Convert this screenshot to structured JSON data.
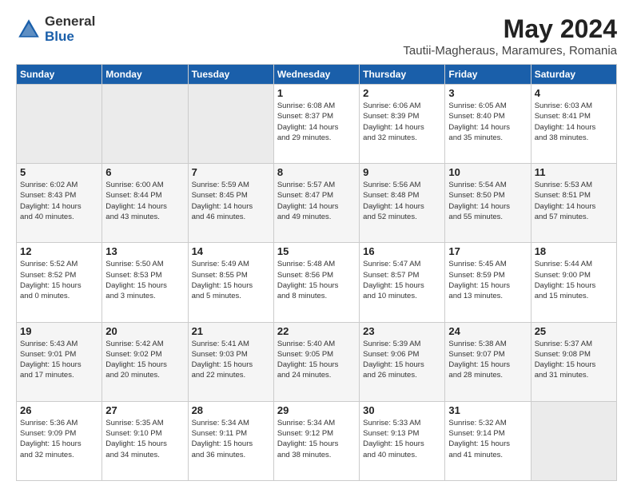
{
  "header": {
    "logo_general": "General",
    "logo_blue": "Blue",
    "month_year": "May 2024",
    "location": "Tautii-Magheraus, Maramures, Romania"
  },
  "weekdays": [
    "Sunday",
    "Monday",
    "Tuesday",
    "Wednesday",
    "Thursday",
    "Friday",
    "Saturday"
  ],
  "weeks": [
    [
      {
        "day": "",
        "info": ""
      },
      {
        "day": "",
        "info": ""
      },
      {
        "day": "",
        "info": ""
      },
      {
        "day": "1",
        "info": "Sunrise: 6:08 AM\nSunset: 8:37 PM\nDaylight: 14 hours\nand 29 minutes."
      },
      {
        "day": "2",
        "info": "Sunrise: 6:06 AM\nSunset: 8:39 PM\nDaylight: 14 hours\nand 32 minutes."
      },
      {
        "day": "3",
        "info": "Sunrise: 6:05 AM\nSunset: 8:40 PM\nDaylight: 14 hours\nand 35 minutes."
      },
      {
        "day": "4",
        "info": "Sunrise: 6:03 AM\nSunset: 8:41 PM\nDaylight: 14 hours\nand 38 minutes."
      }
    ],
    [
      {
        "day": "5",
        "info": "Sunrise: 6:02 AM\nSunset: 8:43 PM\nDaylight: 14 hours\nand 40 minutes."
      },
      {
        "day": "6",
        "info": "Sunrise: 6:00 AM\nSunset: 8:44 PM\nDaylight: 14 hours\nand 43 minutes."
      },
      {
        "day": "7",
        "info": "Sunrise: 5:59 AM\nSunset: 8:45 PM\nDaylight: 14 hours\nand 46 minutes."
      },
      {
        "day": "8",
        "info": "Sunrise: 5:57 AM\nSunset: 8:47 PM\nDaylight: 14 hours\nand 49 minutes."
      },
      {
        "day": "9",
        "info": "Sunrise: 5:56 AM\nSunset: 8:48 PM\nDaylight: 14 hours\nand 52 minutes."
      },
      {
        "day": "10",
        "info": "Sunrise: 5:54 AM\nSunset: 8:50 PM\nDaylight: 14 hours\nand 55 minutes."
      },
      {
        "day": "11",
        "info": "Sunrise: 5:53 AM\nSunset: 8:51 PM\nDaylight: 14 hours\nand 57 minutes."
      }
    ],
    [
      {
        "day": "12",
        "info": "Sunrise: 5:52 AM\nSunset: 8:52 PM\nDaylight: 15 hours\nand 0 minutes."
      },
      {
        "day": "13",
        "info": "Sunrise: 5:50 AM\nSunset: 8:53 PM\nDaylight: 15 hours\nand 3 minutes."
      },
      {
        "day": "14",
        "info": "Sunrise: 5:49 AM\nSunset: 8:55 PM\nDaylight: 15 hours\nand 5 minutes."
      },
      {
        "day": "15",
        "info": "Sunrise: 5:48 AM\nSunset: 8:56 PM\nDaylight: 15 hours\nand 8 minutes."
      },
      {
        "day": "16",
        "info": "Sunrise: 5:47 AM\nSunset: 8:57 PM\nDaylight: 15 hours\nand 10 minutes."
      },
      {
        "day": "17",
        "info": "Sunrise: 5:45 AM\nSunset: 8:59 PM\nDaylight: 15 hours\nand 13 minutes."
      },
      {
        "day": "18",
        "info": "Sunrise: 5:44 AM\nSunset: 9:00 PM\nDaylight: 15 hours\nand 15 minutes."
      }
    ],
    [
      {
        "day": "19",
        "info": "Sunrise: 5:43 AM\nSunset: 9:01 PM\nDaylight: 15 hours\nand 17 minutes."
      },
      {
        "day": "20",
        "info": "Sunrise: 5:42 AM\nSunset: 9:02 PM\nDaylight: 15 hours\nand 20 minutes."
      },
      {
        "day": "21",
        "info": "Sunrise: 5:41 AM\nSunset: 9:03 PM\nDaylight: 15 hours\nand 22 minutes."
      },
      {
        "day": "22",
        "info": "Sunrise: 5:40 AM\nSunset: 9:05 PM\nDaylight: 15 hours\nand 24 minutes."
      },
      {
        "day": "23",
        "info": "Sunrise: 5:39 AM\nSunset: 9:06 PM\nDaylight: 15 hours\nand 26 minutes."
      },
      {
        "day": "24",
        "info": "Sunrise: 5:38 AM\nSunset: 9:07 PM\nDaylight: 15 hours\nand 28 minutes."
      },
      {
        "day": "25",
        "info": "Sunrise: 5:37 AM\nSunset: 9:08 PM\nDaylight: 15 hours\nand 31 minutes."
      }
    ],
    [
      {
        "day": "26",
        "info": "Sunrise: 5:36 AM\nSunset: 9:09 PM\nDaylight: 15 hours\nand 32 minutes."
      },
      {
        "day": "27",
        "info": "Sunrise: 5:35 AM\nSunset: 9:10 PM\nDaylight: 15 hours\nand 34 minutes."
      },
      {
        "day": "28",
        "info": "Sunrise: 5:34 AM\nSunset: 9:11 PM\nDaylight: 15 hours\nand 36 minutes."
      },
      {
        "day": "29",
        "info": "Sunrise: 5:34 AM\nSunset: 9:12 PM\nDaylight: 15 hours\nand 38 minutes."
      },
      {
        "day": "30",
        "info": "Sunrise: 5:33 AM\nSunset: 9:13 PM\nDaylight: 15 hours\nand 40 minutes."
      },
      {
        "day": "31",
        "info": "Sunrise: 5:32 AM\nSunset: 9:14 PM\nDaylight: 15 hours\nand 41 minutes."
      },
      {
        "day": "",
        "info": ""
      }
    ]
  ]
}
